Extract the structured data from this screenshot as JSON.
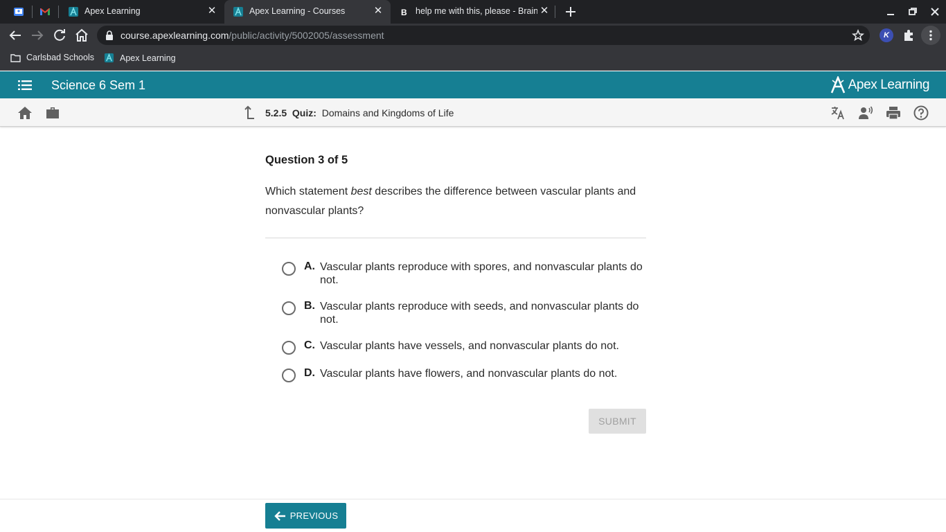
{
  "browser": {
    "tabs": [
      {
        "title": ""
      },
      {
        "title": ""
      },
      {
        "title": "Apex Learning"
      },
      {
        "title": "Apex Learning - Courses"
      },
      {
        "title": "help me with this, please - Brainly"
      }
    ],
    "url": {
      "host": "course.apexlearning.com",
      "path": "/public/activity/5002005/assessment"
    },
    "bookmarks": [
      {
        "label": "Carlsbad Schools"
      },
      {
        "label": "Apex Learning"
      }
    ],
    "extension_letter": "K"
  },
  "app": {
    "course_title": "Science 6 Sem 1",
    "brand": "Apex Learning",
    "breadcrumb": {
      "number": "5.2.5",
      "type": "Quiz:",
      "title": "Domains and Kingdoms of Life"
    }
  },
  "question": {
    "counter": "Question 3 of 5",
    "text_before": "Which statement ",
    "text_emphasis": "best",
    "text_after": " describes the difference between vascular plants and nonvascular plants?",
    "options": [
      {
        "letter": "A.",
        "text": "Vascular plants reproduce with spores, and nonvascular plants do not."
      },
      {
        "letter": "B.",
        "text": "Vascular plants reproduce with seeds, and nonvascular plants do not."
      },
      {
        "letter": "C.",
        "text": "Vascular plants have vessels, and nonvascular plants do not."
      },
      {
        "letter": "D.",
        "text": "Vascular plants have flowers, and nonvascular plants do not."
      }
    ],
    "submit_label": "SUBMIT"
  },
  "footer": {
    "previous_label": "PREVIOUS"
  },
  "colors": {
    "brand_teal": "#167f93",
    "chrome_dark": "#202124",
    "chrome_mid": "#35363a"
  }
}
